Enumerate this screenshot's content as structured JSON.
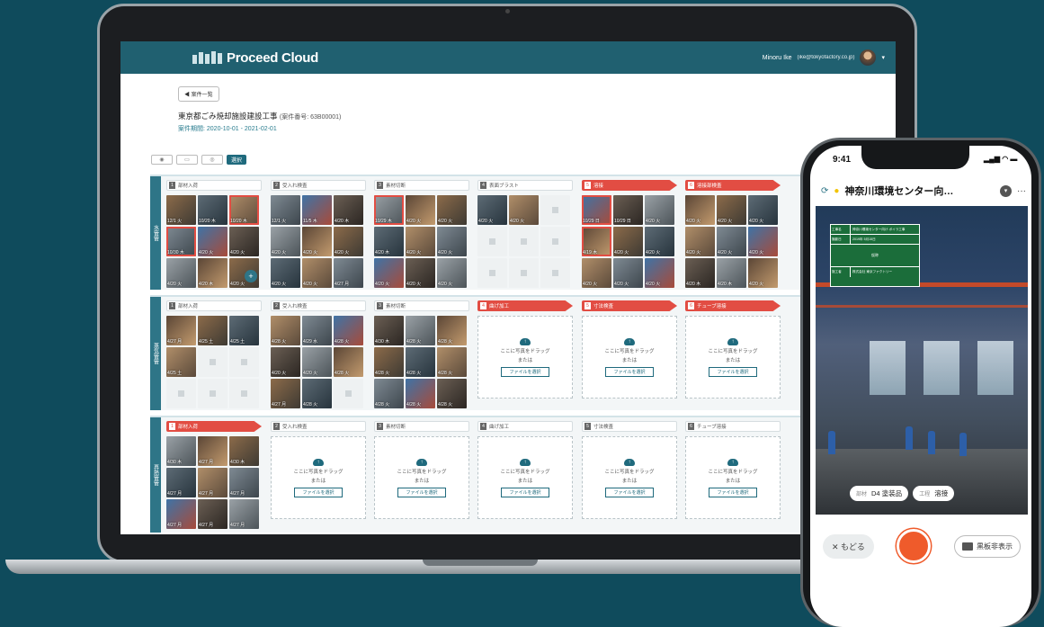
{
  "app": {
    "name": "Proceed Cloud",
    "user_name": "Minoru Ike",
    "user_email": "(ike@tokyofactory.co.jp)"
  },
  "project": {
    "back_label": "◀ 案件一覧",
    "title": "東京都ごみ焼却施設建設工事",
    "number": "(案件番号: 63B00001)",
    "period": "案件期間: 2020-10-01 - 2021-02-01"
  },
  "toolbar": {
    "edit_label": "選択"
  },
  "sections": [
    {
      "name": "水管管",
      "columns": [
        {
          "num": "1",
          "label": "部材入荷",
          "red": false,
          "thumbs": [
            "12/1 火",
            "10/20 木",
            "10/20 木",
            "10/30 木",
            "4/20 火",
            "4/20 火",
            "4/20 火",
            "4/20 木",
            "4/20 火"
          ]
        },
        {
          "num": "2",
          "label": "受入れ検査",
          "red": false,
          "thumbs": [
            "12/1 火",
            "11/5 木",
            "4/20 木",
            "4/20 火",
            "4/20 火",
            "4/20 火",
            "4/20 火",
            "4/20 火",
            "4/27 月"
          ]
        },
        {
          "num": "3",
          "label": "素材切断",
          "red": false,
          "thumbs": [
            "10/29 木",
            "4/20 火",
            "4/20 火",
            "4/20 木",
            "4/20 火",
            "4/20 火",
            "4/20 火",
            "4/20 火",
            "4/20 火"
          ]
        },
        {
          "num": "4",
          "label": "表面ブラスト",
          "red": false,
          "thumbs": [
            "4/20 火",
            "4/20 火",
            "",
            "",
            "",
            "",
            "",
            "",
            ""
          ]
        },
        {
          "num": "5",
          "label": "溶接",
          "red": true,
          "thumbs": [
            "10/29 日",
            "10/29 日",
            "4/20 火",
            "4/19 木",
            "4/20 火",
            "4/20 火",
            "4/20 火",
            "4/20 火",
            "4/20 火"
          ]
        },
        {
          "num": "6",
          "label": "溶接部検査",
          "red": true,
          "thumbs": [
            "4/20 火",
            "4/20 火",
            "4/20 火",
            "4/20 火",
            "4/20 火",
            "4/20 火",
            "4/20 木",
            "4/20 木",
            "4/20 火"
          ]
        }
      ]
    },
    {
      "name": "蒸気管管",
      "columns": [
        {
          "num": "1",
          "label": "部材入荷",
          "red": false,
          "thumbs": [
            "4/27 月",
            "4/25 土",
            "4/25 土",
            "4/25 土",
            "",
            "",
            "",
            "",
            ""
          ]
        },
        {
          "num": "2",
          "label": "受入れ検査",
          "red": false,
          "thumbs": [
            "4/28 火",
            "4/29 水",
            "4/28 火",
            "4/20 火",
            "4/20 火",
            "4/28 火",
            "4/27 月",
            "4/28 火",
            ""
          ]
        },
        {
          "num": "3",
          "label": "素材切断",
          "red": false,
          "thumbs": [
            "4/30 木",
            "4/28 火",
            "4/28 火",
            "4/28 火",
            "4/28 火",
            "4/28 火",
            "4/28 火",
            "4/28 火",
            "4/28 火"
          ]
        },
        {
          "num": "4",
          "label": "曲げ加工",
          "red": true,
          "drop": true
        },
        {
          "num": "5",
          "label": "寸法検査",
          "red": true,
          "drop": true
        },
        {
          "num": "6",
          "label": "チューブ溶接",
          "red": true,
          "drop": true
        }
      ]
    },
    {
      "name": "再熱管管",
      "columns": [
        {
          "num": "1",
          "label": "部材入荷",
          "red": true,
          "thumbs": [
            "4/30 木",
            "4/27 月",
            "4/30 木",
            "4/27 月",
            "4/27 月",
            "4/27 月",
            "4/27 月",
            "4/27 月",
            "4/27 月"
          ]
        },
        {
          "num": "2",
          "label": "受入れ検査",
          "red": false,
          "drop": true
        },
        {
          "num": "3",
          "label": "素材切断",
          "red": false,
          "drop": true
        },
        {
          "num": "4",
          "label": "曲げ加工",
          "red": false,
          "drop": true
        },
        {
          "num": "5",
          "label": "寸法検査",
          "red": false,
          "drop": true
        },
        {
          "num": "6",
          "label": "チューブ溶接",
          "red": false,
          "drop": true
        }
      ]
    }
  ],
  "dropzone": {
    "text": "ここに写真をドラッグ",
    "or": "または",
    "button": "ファイルを選択"
  },
  "phone": {
    "time": "9:41",
    "status_icons": "▂▄▆ ◠ ▬",
    "title": "神奈川環境センター向…",
    "board": {
      "row1_key": "工事名",
      "row1_val": "神奈川環境センター向け ボイラ工事",
      "row2_key": "撮影日",
      "row2_val": "2019年 5月15日",
      "mid": "仮称",
      "row3_key": "施工者",
      "row3_val": "株式会社 東京ファクトリー"
    },
    "tag1_key": "部材",
    "tag1_val": "D4 塗装品",
    "tag2_key": "工程",
    "tag2_val": "溶接",
    "back_label": "✕ もどる",
    "board_toggle_label": "黒板非表示"
  },
  "colors": {
    "background": "#0f4b5c",
    "header": "#206070",
    "accent_red": "#e24d43",
    "shutter": "#ef5b2b"
  }
}
